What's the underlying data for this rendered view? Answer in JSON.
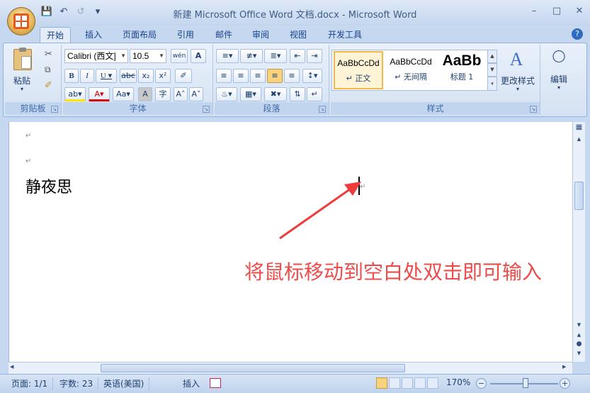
{
  "window": {
    "title": "新建 Microsoft Office Word 文档.docx - Microsoft Word",
    "minimize_icon": "minimize-icon",
    "maximize_icon": "maximize-icon",
    "close_icon": "close-icon"
  },
  "quick_access": {
    "save": "save-icon",
    "undo": "undo-icon",
    "redo": "redo-icon",
    "customize": "dropdown-icon"
  },
  "tabs": [
    "开始",
    "插入",
    "页面布局",
    "引用",
    "邮件",
    "审阅",
    "视图",
    "开发工具"
  ],
  "ribbon": {
    "clipboard": {
      "paste_label": "粘贴",
      "group_label": "剪贴板"
    },
    "font": {
      "font_name": "Calibri (西文]",
      "font_size": "10.5",
      "group_label": "字体"
    },
    "paragraph": {
      "group_label": "段落"
    },
    "styles": {
      "items": [
        {
          "sample": "AaBbCcDd",
          "name": "↵ 正文"
        },
        {
          "sample": "AaBbCcDd",
          "name": "↵ 无间隔"
        },
        {
          "sample": "AaBb",
          "name": "标题 1"
        }
      ],
      "change_styles_label": "更改样式",
      "group_label": "样式"
    },
    "editing": {
      "label": "编辑"
    }
  },
  "document": {
    "content": "静夜思",
    "annotation": "将鼠标移动到空白处双击即可输入",
    "para_mark": "↵"
  },
  "statusbar": {
    "page": "页面: 1/1",
    "words": "字数: 23",
    "language": "英语(美国)",
    "insert_mode": "插入",
    "zoom": "170%"
  },
  "colors": {
    "annotation": "#ee4b4b",
    "arrow": "#ee3b3b"
  }
}
